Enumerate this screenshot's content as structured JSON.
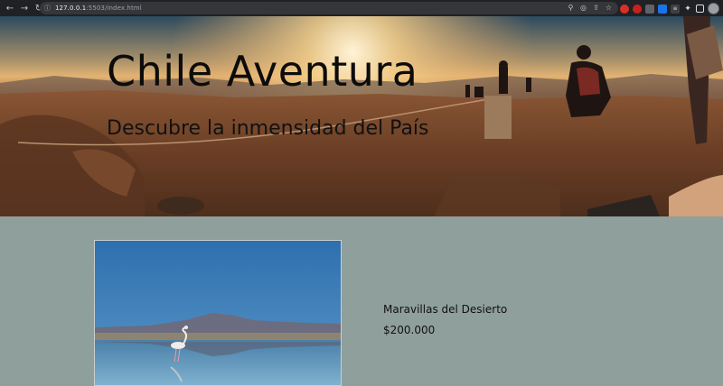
{
  "browser": {
    "url_host": "127.0.0.1",
    "url_rest": ":5503/index.html",
    "icons": [
      "back-icon",
      "forward-icon",
      "reload-icon",
      "zoom-icon",
      "share-icon",
      "bookmark-star-icon",
      "extensions-icon",
      "sidebar-icon",
      "profile-icon",
      "menu-icon"
    ]
  },
  "hero": {
    "title": "Chile Aventura",
    "subtitle": "Descubre la inmensidad del País"
  },
  "product": {
    "name": "Maravillas del Desierto",
    "price": "$200.000"
  }
}
